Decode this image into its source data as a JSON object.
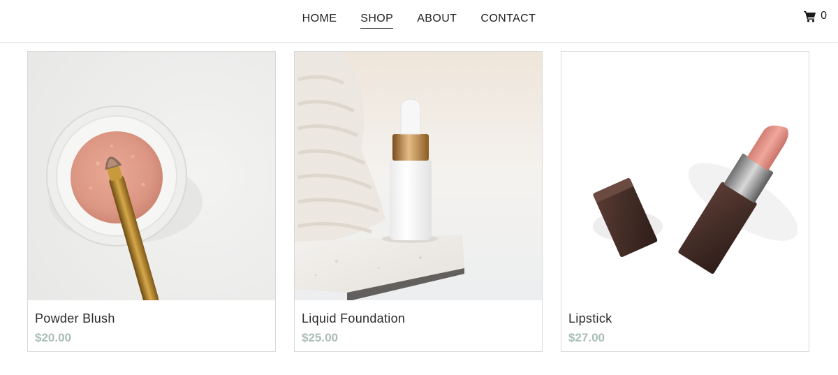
{
  "nav": {
    "items": [
      {
        "label": "HOME",
        "active": false
      },
      {
        "label": "SHOP",
        "active": true
      },
      {
        "label": "ABOUT",
        "active": false
      },
      {
        "label": "CONTACT",
        "active": false
      }
    ]
  },
  "cart": {
    "icon": "shopping-cart-icon",
    "count": "0"
  },
  "products": [
    {
      "name": "Powder Blush",
      "price": "$20.00",
      "image": "powder-blush-photo"
    },
    {
      "name": "Liquid Foundation",
      "price": "$25.00",
      "image": "liquid-foundation-photo"
    },
    {
      "name": "Lipstick",
      "price": "$27.00",
      "image": "lipstick-photo"
    }
  ],
  "colors": {
    "price": "#a9bdb8",
    "text": "#1e1e1e",
    "border": "#d8d8d8"
  }
}
